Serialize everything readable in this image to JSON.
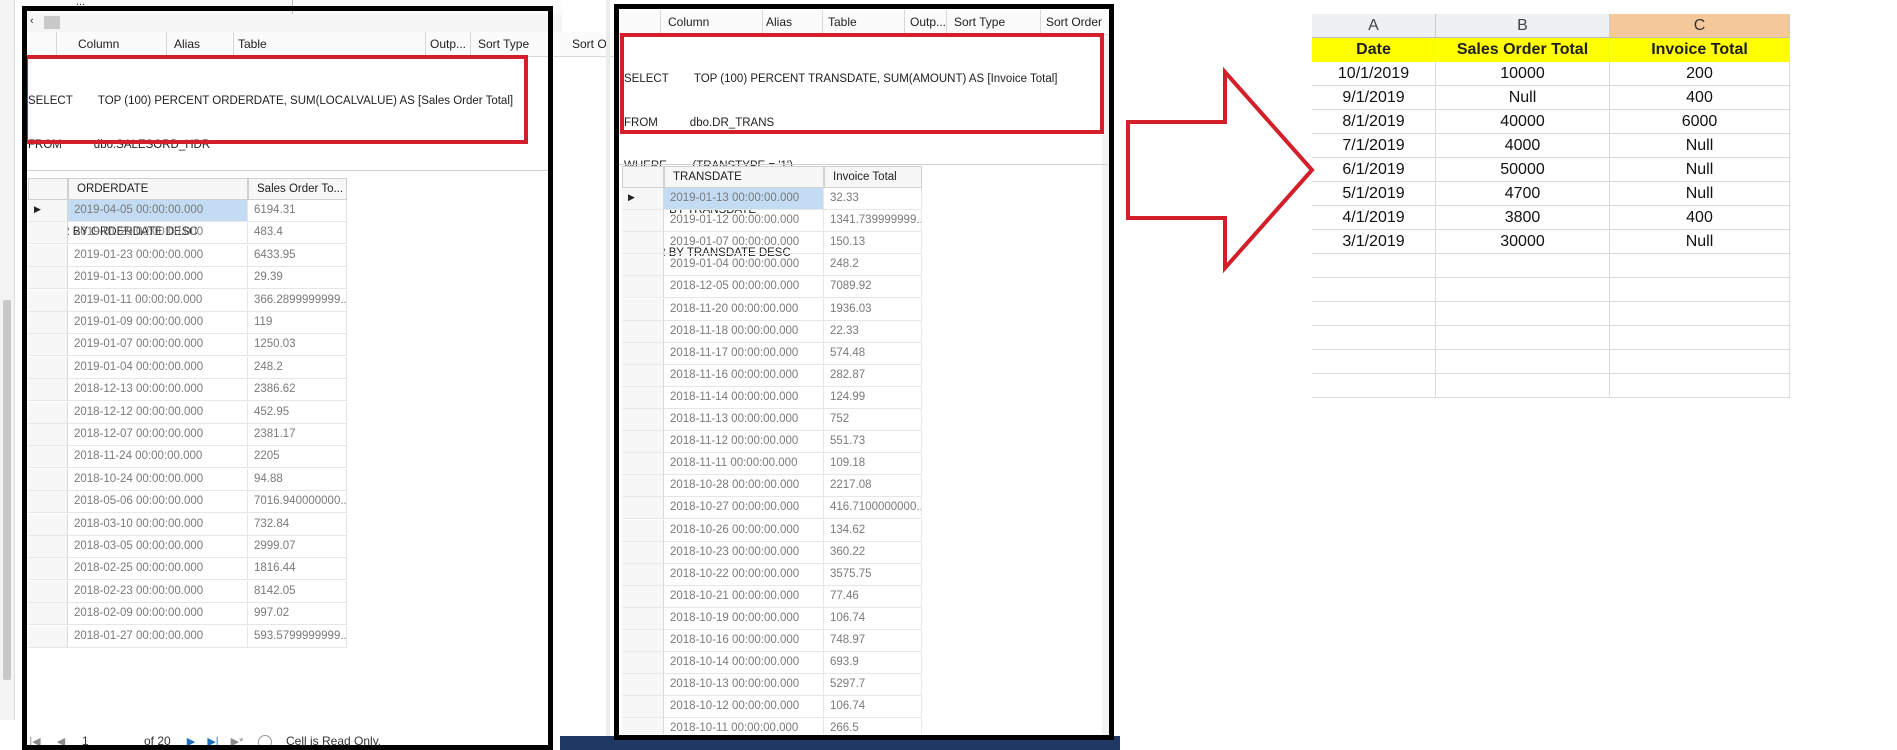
{
  "left_panel": {
    "partial_title": "...",
    "columns": [
      "Column",
      "Alias",
      "Table",
      "Outp...",
      "Sort Type",
      "Sort O"
    ],
    "sql": [
      "SELECT        TOP (100) PERCENT ORDERDATE, SUM(LOCALVALUE) AS [Sales Order Total]",
      "FROM          dbo.SALESORD_HDR",
      "GROUP BY ORDERDATE",
      "ORDER BY ORDERDATE DESC"
    ],
    "grid_headers": [
      "ORDERDATE",
      "Sales Order To..."
    ],
    "rows": [
      [
        "2019-04-05 00:00:00.000",
        "6194.31"
      ],
      [
        "2019-01-29 00:00:00.000",
        "483.4"
      ],
      [
        "2019-01-23 00:00:00.000",
        "6433.95"
      ],
      [
        "2019-01-13 00:00:00.000",
        "29.39"
      ],
      [
        "2019-01-11 00:00:00.000",
        "366.2899999999..."
      ],
      [
        "2019-01-09 00:00:00.000",
        "119"
      ],
      [
        "2019-01-07 00:00:00.000",
        "1250.03"
      ],
      [
        "2019-01-04 00:00:00.000",
        "248.2"
      ],
      [
        "2018-12-13 00:00:00.000",
        "2386.62"
      ],
      [
        "2018-12-12 00:00:00.000",
        "452.95"
      ],
      [
        "2018-12-07 00:00:00.000",
        "2381.17"
      ],
      [
        "2018-11-24 00:00:00.000",
        "2205"
      ],
      [
        "2018-10-24 00:00:00.000",
        "94.88"
      ],
      [
        "2018-05-06 00:00:00.000",
        "7016.940000000..."
      ],
      [
        "2018-03-10 00:00:00.000",
        "732.84"
      ],
      [
        "2018-03-05 00:00:00.000",
        "2999.07"
      ],
      [
        "2018-02-25 00:00:00.000",
        "1816.44"
      ],
      [
        "2018-02-23 00:00:00.000",
        "8142.05"
      ],
      [
        "2018-02-09 00:00:00.000",
        "997.02"
      ],
      [
        "2018-01-27 00:00:00.000",
        "593.5799999999..."
      ]
    ],
    "nav": {
      "page": "1",
      "of_pages": "of 20",
      "status": "Cell is Read Only."
    }
  },
  "middle_panel": {
    "columns": [
      "Column",
      "Alias",
      "Table",
      "Outp...",
      "Sort Type",
      "Sort Order"
    ],
    "sql": [
      "SELECT        TOP (100) PERCENT TRANSDATE, SUM(AMOUNT) AS [Invoice Total]",
      "FROM          dbo.DR_TRANS",
      "WHERE        (TRANSTYPE = '1')",
      "GROUP BY TRANSDATE",
      "ORDER BY TRANSDATE DESC"
    ],
    "grid_headers": [
      "TRANSDATE",
      "Invoice Total"
    ],
    "rows": [
      [
        "2019-01-13 00:00:00.000",
        "32.33"
      ],
      [
        "2019-01-12 00:00:00.000",
        "1341.739999999..."
      ],
      [
        "2019-01-07 00:00:00.000",
        "150.13"
      ],
      [
        "2019-01-04 00:00:00.000",
        "248.2"
      ],
      [
        "2018-12-05 00:00:00.000",
        "7089.92"
      ],
      [
        "2018-11-20 00:00:00.000",
        "1936.03"
      ],
      [
        "2018-11-18 00:00:00.000",
        "22.33"
      ],
      [
        "2018-11-17 00:00:00.000",
        "574.48"
      ],
      [
        "2018-11-16 00:00:00.000",
        "282.87"
      ],
      [
        "2018-11-14 00:00:00.000",
        "124.99"
      ],
      [
        "2018-11-13 00:00:00.000",
        "752"
      ],
      [
        "2018-11-12 00:00:00.000",
        "551.73"
      ],
      [
        "2018-11-11 00:00:00.000",
        "109.18"
      ],
      [
        "2018-10-28 00:00:00.000",
        "2217.08"
      ],
      [
        "2018-10-27 00:00:00.000",
        "416.7100000000..."
      ],
      [
        "2018-10-26 00:00:00.000",
        "134.62"
      ],
      [
        "2018-10-23 00:00:00.000",
        "360.22"
      ],
      [
        "2018-10-22 00:00:00.000",
        "3575.75"
      ],
      [
        "2018-10-21 00:00:00.000",
        "77.46"
      ],
      [
        "2018-10-19 00:00:00.000",
        "106.74"
      ],
      [
        "2018-10-16 00:00:00.000",
        "748.97"
      ],
      [
        "2018-10-14 00:00:00.000",
        "693.9"
      ],
      [
        "2018-10-13 00:00:00.000",
        "5297.7"
      ],
      [
        "2018-10-12 00:00:00.000",
        "106.74"
      ],
      [
        "2018-10-11 00:00:00.000",
        "266.5"
      ]
    ]
  },
  "excel": {
    "col_letters": [
      "A",
      "B",
      "C"
    ],
    "headers": [
      "Date",
      "Sales Order Total",
      "Invoice Total"
    ],
    "rows": [
      [
        "10/1/2019",
        "10000",
        "200"
      ],
      [
        "9/1/2019",
        "Null",
        "400"
      ],
      [
        "8/1/2019",
        "40000",
        "6000"
      ],
      [
        "7/1/2019",
        "4000",
        "Null"
      ],
      [
        "6/1/2019",
        "50000",
        "Null"
      ],
      [
        "5/1/2019",
        "4700",
        "Null"
      ],
      [
        "4/1/2019",
        "3800",
        "400"
      ],
      [
        "3/1/2019",
        "30000",
        "Null"
      ]
    ]
  },
  "colors": {
    "highlight_box": "#d21f2a",
    "frame": "#000000",
    "excel_header_fill": "#ffff00",
    "excel_active_col": "#f4c89a",
    "selected_cell": "#c3dcf3"
  }
}
